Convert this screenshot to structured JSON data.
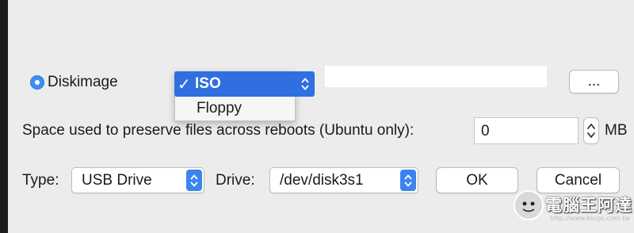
{
  "source": {
    "diskimage_label": "Diskimage",
    "browse_label": "...",
    "menu": {
      "selected_check": "✓",
      "items": [
        "ISO",
        "Floppy"
      ]
    }
  },
  "persistence": {
    "label": "Space used to preserve files across reboots (Ubuntu only):",
    "value": "0",
    "unit": "MB"
  },
  "target": {
    "type_label": "Type:",
    "type_value": "USB Drive",
    "drive_label": "Drive:",
    "drive_value": "/dev/disk3s1"
  },
  "buttons": {
    "ok": "OK",
    "cancel": "Cancel"
  },
  "watermark": {
    "text": "電腦王阿達",
    "url": "http://www.kocpc.com.tw"
  },
  "colors": {
    "accent": "#3b84f0",
    "menu_highlight": "#2f6fe0",
    "dialog_bg": "#ececec"
  }
}
